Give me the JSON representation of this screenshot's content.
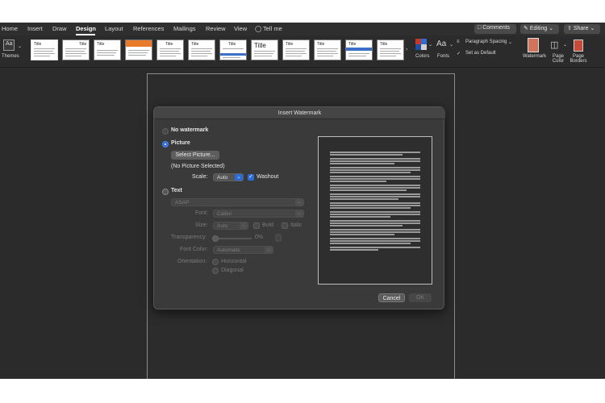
{
  "ribbon_tabs": [
    "Home",
    "Insert",
    "Draw",
    "Design",
    "Layout",
    "References",
    "Mailings",
    "Review",
    "View"
  ],
  "tell_me": "Tell me",
  "top_right": {
    "comments": "Comments",
    "editing": "Editing",
    "share": "Share"
  },
  "ribbon": {
    "themes": "Themes",
    "thumb_title": "Title",
    "colors": "Colors",
    "fonts": "Fonts",
    "paragraph_spacing": "Paragraph Spacing",
    "set_as_default": "Set as Default",
    "watermark": "Watermark",
    "page_color": "Page Color",
    "page_borders": "Page Borders"
  },
  "dialog": {
    "title": "Insert Watermark",
    "no_watermark": "No watermark",
    "picture": "Picture",
    "select_picture": "Select Picture...",
    "no_picture": "(No Picture Selected)",
    "scale_label": "Scale:",
    "scale_value": "Auto",
    "washout": "Washout",
    "text": "Text",
    "text_value": "ASAP",
    "font_label": "Font:",
    "font_value": "Calibri",
    "size_label": "Size:",
    "size_value": "Auto",
    "bold": "Bold",
    "italic": "Italic",
    "transparency_label": "Transparency:",
    "transparency_value": "0%",
    "font_color_label": "Font Color:",
    "font_color_value": "Automatic",
    "orientation_label": "Orientation:",
    "horizontal": "Horizontal",
    "diagonal": "Diagonal",
    "cancel": "Cancel",
    "ok": "OK"
  },
  "colors": {
    "accent": "#2d6bd8",
    "background": "#2b2b2b",
    "dialog": "#3a3a3a"
  }
}
